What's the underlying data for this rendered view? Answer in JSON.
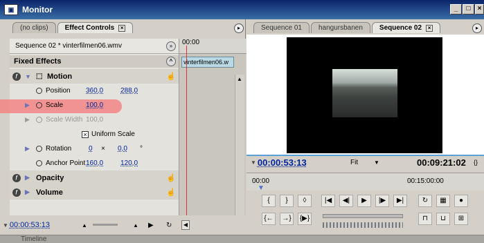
{
  "window": {
    "title": "Monitor"
  },
  "left_panel": {
    "tabs": [
      {
        "label": "(no clips)"
      },
      {
        "label": "Effect Controls"
      }
    ],
    "sequence_label": "Sequence 02 * vinterfilmen06.wmv",
    "fixed_effects": "Fixed Effects",
    "timeline_ruler": "00:00",
    "clip_name": "vinterfilmen06.w",
    "motion": {
      "label": "Motion",
      "position": {
        "label": "Position",
        "x": "360,0",
        "y": "288,0"
      },
      "scale": {
        "label": "Scale",
        "value": "100,0"
      },
      "scale_width": {
        "label": "Scale Width",
        "value": "100,0"
      },
      "uniform_scale": "Uniform Scale",
      "rotation": {
        "label": "Rotation",
        "turns": "0",
        "x": "×",
        "degrees": "0,0",
        "unit": "°"
      },
      "anchor_point": {
        "label": "Anchor Point",
        "x": "160,0",
        "y": "120,0"
      }
    },
    "opacity": {
      "label": "Opacity"
    },
    "volume": {
      "label": "Volume"
    },
    "current_time": "00:00:53:13"
  },
  "right_panel": {
    "tabs": [
      {
        "label": "Sequence 01"
      },
      {
        "label": "hangursbanen"
      },
      {
        "label": "Sequence 02"
      }
    ],
    "current_timecode": "00:00:53:13",
    "zoom": "Fit",
    "duration": "00:09:21:02",
    "ruler_start": "00:00",
    "ruler_mid": "00:15:00:00"
  },
  "footer": {
    "label": "Timeline"
  }
}
